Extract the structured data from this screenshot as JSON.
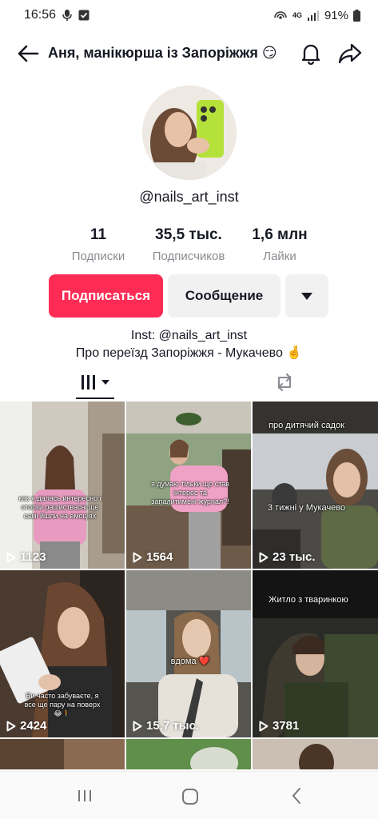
{
  "status_bar": {
    "time": "16:56",
    "network": "4G",
    "battery": "91%"
  },
  "header": {
    "title": "Аня, манікюрша із Запоріжжя 😏"
  },
  "profile": {
    "username": "@nails_art_inst",
    "stats": [
      {
        "value": "11",
        "label": "Подписки"
      },
      {
        "value": "35,5 тыс.",
        "label": "Подписчиков"
      },
      {
        "value": "1,6 млн",
        "label": "Лайки"
      }
    ],
    "follow_label": "Подписаться",
    "message_label": "Сообщение",
    "bio_lines": [
      "Inst: @nails_art_inst",
      "Про переїзд Запоріжжя - Мукачево 🤞"
    ]
  },
  "videos": [
    {
      "views": "1123",
      "caption": "как я далась интересно і стопки рашиствасні ще самі йшли на емоціях"
    },
    {
      "views": "1564",
      "caption": "я думаю тільки що став інтерес та запалитимені журнал?!"
    },
    {
      "views": "23 тыс.",
      "caption": "про дитячий садок",
      "caption2": "3 тижні у Мукачево"
    },
    {
      "views": "2424",
      "caption": "Ви часто забуваєте, я все ще пару на поверх 😂🚶"
    },
    {
      "views": "15,7 тыс.",
      "caption": "вдома ❤️"
    },
    {
      "views": "3781",
      "caption": "Житло з тваринкою"
    }
  ],
  "colors": {
    "accent": "#fe2c55",
    "secondary_button": "#f1f1f2",
    "muted_text": "#8a8b91"
  }
}
